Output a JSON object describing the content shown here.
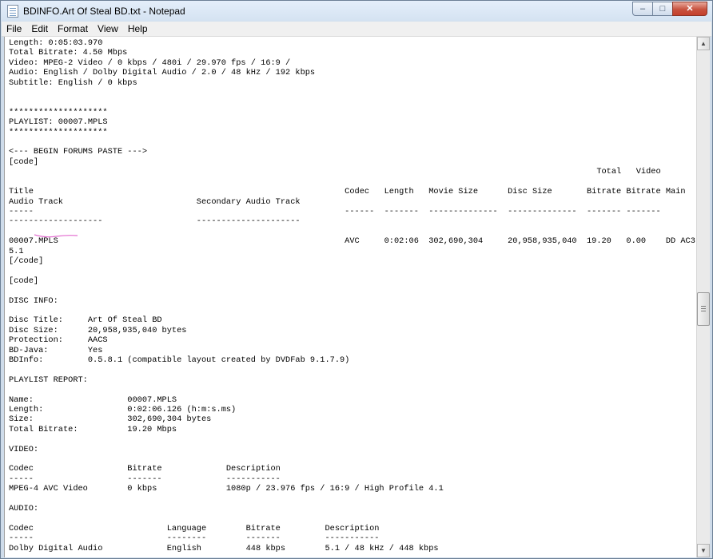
{
  "window": {
    "title": "BDINFO.Art Of Steal BD.txt - Notepad",
    "close_color": "#c8523f"
  },
  "caption_buttons": {
    "minimize_glyph": "–",
    "maximize_glyph": "□",
    "close_glyph": "✕"
  },
  "menu": {
    "items": [
      "File",
      "Edit",
      "Format",
      "View",
      "Help"
    ]
  },
  "scrollbar": {
    "up_glyph": "▲",
    "down_glyph": "▼"
  },
  "document": {
    "text": "Length: 0:05:03.970\nTotal Bitrate: 4.50 Mbps\nVideo: MPEG-2 Video / 0 kbps / 480i / 29.970 fps / 16:9 /\nAudio: English / Dolby Digital Audio / 2.0 / 48 kHz / 192 kbps\nSubtitle: English / 0 kbps\n\n\n********************\nPLAYLIST: 00007.MPLS\n********************\n\n<--- BEGIN FORUMS PASTE --->\n[code]\n                                                                                                                       Total   Video\n\nTitle                                                               Codec   Length   Movie Size      Disc Size       Bitrate Bitrate Main\nAudio Track                           Secondary Audio Track\n-----                                                               ------  -------  --------------  --------------  ------- -------\n-------------------                   ---------------------\n\n00007.MPLS                                                          AVC     0:02:06  302,690,304     20,958,935,040  19.20   0.00    DD AC3\n5.1\n[/code]\n\n[code]\n\nDISC INFO:\n\nDisc Title:     Art Of Steal BD\nDisc Size:      20,958,935,040 bytes\nProtection:     AACS\nBD-Java:        Yes\nBDInfo:         0.5.8.1 (compatible layout created by DVDFab 9.1.7.9)\n\nPLAYLIST REPORT:\n\nName:                   00007.MPLS\nLength:                 0:02:06.126 (h:m:s.ms)\nSize:                   302,690,304 bytes\nTotal Bitrate:          19.20 Mbps\n\nVIDEO:\n\nCodec                   Bitrate             Description\n-----                   -------             -----------\nMPEG-4 AVC Video        0 kbps              1080p / 23.976 fps / 16:9 / High Profile 4.1\n\nAUDIO:\n\nCodec                           Language        Bitrate         Description\n-----                           --------        -------         -----------\nDolby Digital Audio             English         448 kbps        5.1 / 48 kHz / 448 kbps"
  }
}
